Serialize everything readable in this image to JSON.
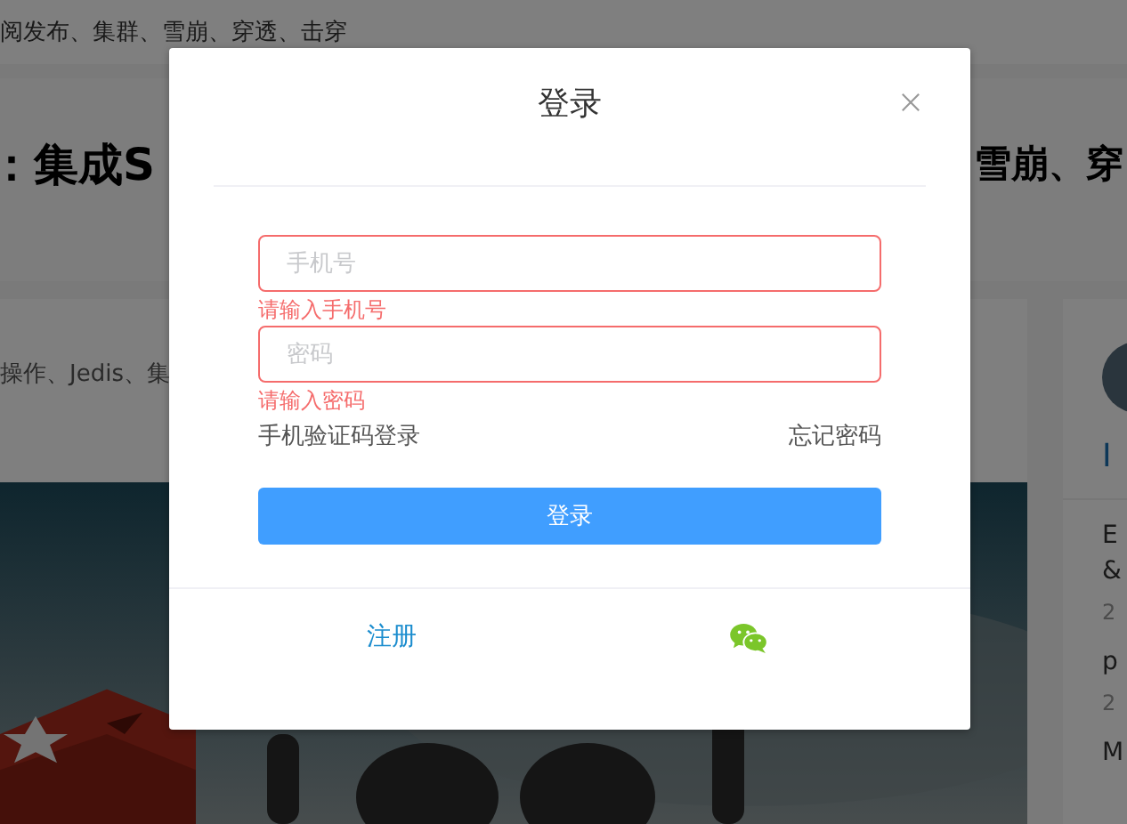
{
  "page": {
    "top_text": "阅发布、集群、雪崩、穿透、击穿",
    "heading_left": "：集成S",
    "heading_right": "雪崩、穿",
    "tags_text": "操作、Jedis、集",
    "sidebar": {
      "section_mark": "I",
      "items": [
        {
          "lines": [
            "E",
            "&"
          ],
          "date": "2"
        },
        {
          "lines": [
            "p"
          ],
          "date": "2"
        },
        {
          "lines": [
            "M"
          ]
        }
      ]
    }
  },
  "dialog": {
    "title": "登录",
    "fields": [
      {
        "placeholder": "手机号",
        "error": "请输入手机号",
        "invalid": true
      },
      {
        "placeholder": "密码",
        "error": "请输入密码",
        "invalid": true
      }
    ],
    "sms_login_link": "手机验证码登录",
    "forgot_link": "忘记密码",
    "submit": "登录",
    "register_link": "注册"
  }
}
